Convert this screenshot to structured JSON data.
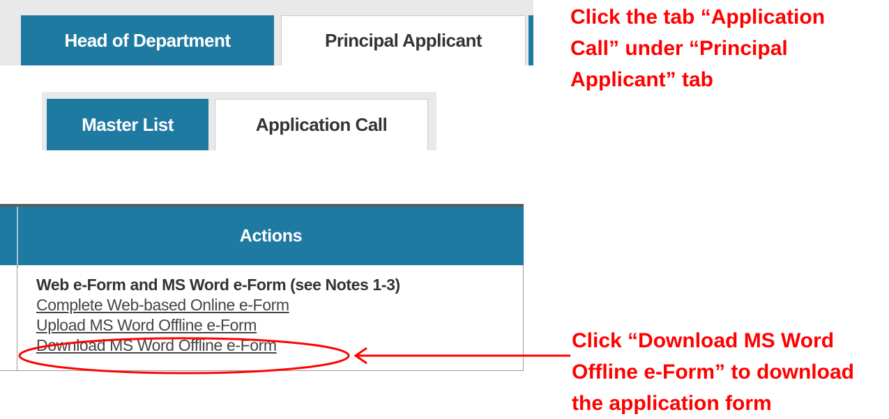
{
  "tabs_top": {
    "items": [
      {
        "label": "Head of Department"
      },
      {
        "label": "Principal Applicant"
      }
    ]
  },
  "tabs_sub": {
    "items": [
      {
        "label": "Master List"
      },
      {
        "label": "Application Call"
      }
    ]
  },
  "actions_table": {
    "header": "Actions",
    "heading": "Web e-Form and MS Word e-Form (see Notes 1-3)",
    "links": [
      {
        "label": "Complete Web-based Online e-Form"
      },
      {
        "label": "Upload MS Word Offline e-Form"
      },
      {
        "label": "Download MS Word Offline e-Form"
      }
    ]
  },
  "annotations": {
    "step1": "Click the tab “Application Call” under “Principal Applicant” tab",
    "step2": "Click “Download MS Word Offline e-Form” to download the application form"
  },
  "colors": {
    "tab_active": "#1f7aa2",
    "annotation": "#ff0000"
  }
}
